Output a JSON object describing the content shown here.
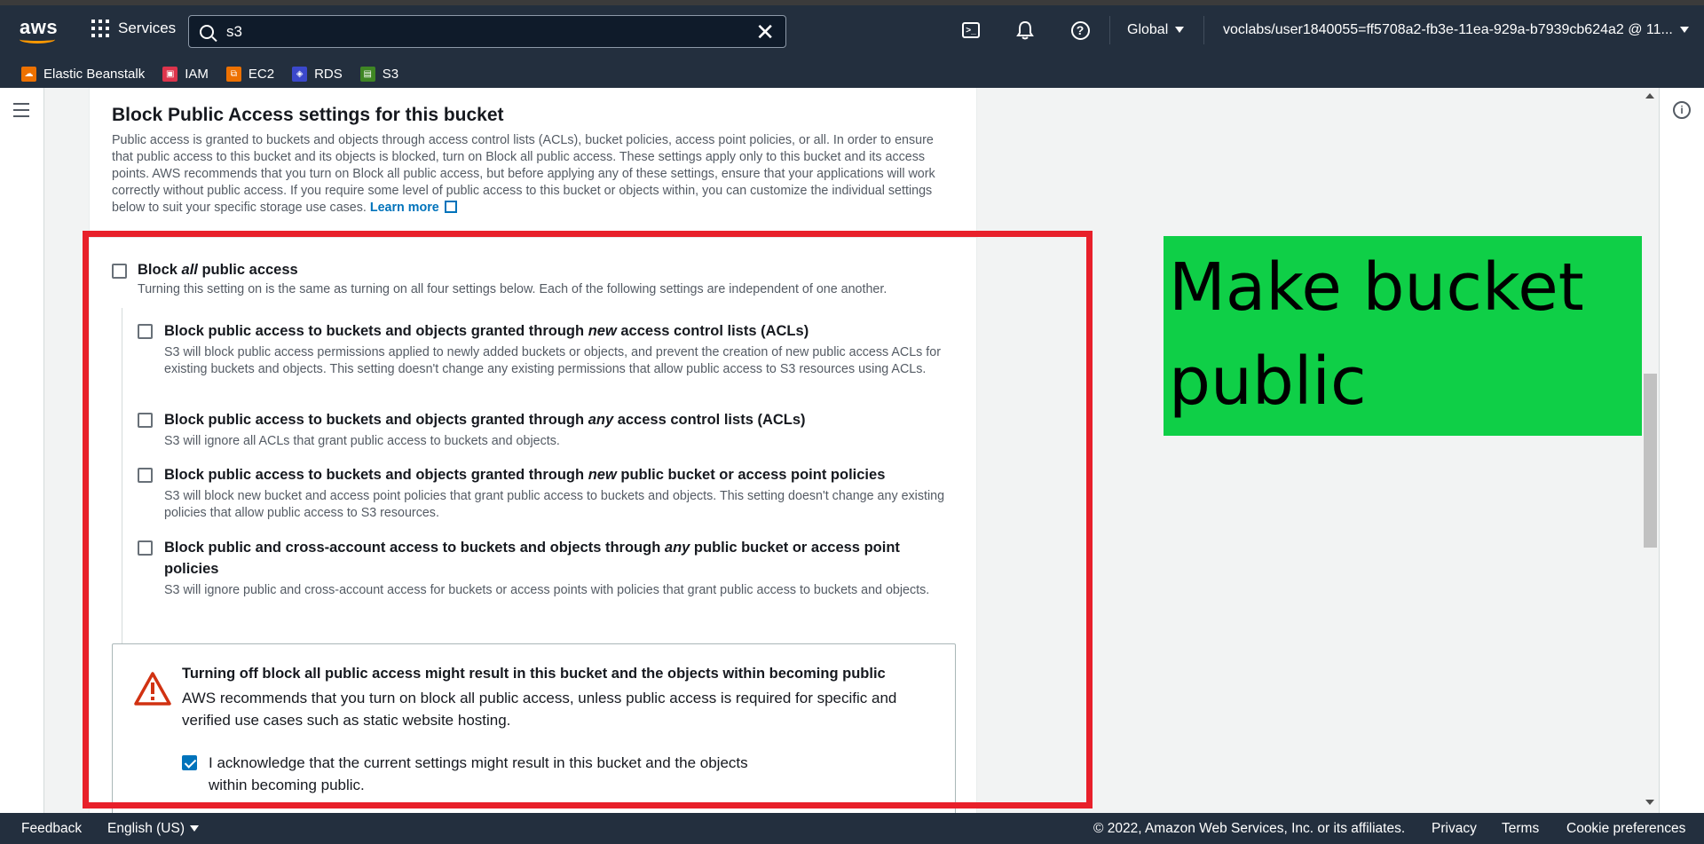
{
  "nav": {
    "logo": "aws",
    "services_label": "Services",
    "search_value": "s3",
    "clear_glyph": "✕",
    "region": "Global",
    "account": "voclabs/user1840055=ff5708a2-fb3e-11ea-929a-b7939cb624a2 @ 11...",
    "icons": [
      "cloudshell-icon",
      "bell-icon",
      "help-icon"
    ]
  },
  "favorites": [
    {
      "label": "Elastic Beanstalk",
      "color": "#ed7100",
      "icon": "beanstalk-icon"
    },
    {
      "label": "IAM",
      "color": "#dd344c",
      "icon": "iam-icon"
    },
    {
      "label": "EC2",
      "color": "#ed7100",
      "icon": "ec2-icon"
    },
    {
      "label": "RDS",
      "color": "#3b48cc",
      "icon": "rds-icon"
    },
    {
      "label": "S3",
      "color": "#3f8624",
      "icon": "s3-icon"
    }
  ],
  "section": {
    "title": "Block Public Access settings for this bucket",
    "description": "Public access is granted to buckets and objects through access control lists (ACLs), bucket policies, access point policies, or all. In order to ensure that public access to this bucket and its objects is blocked, turn on Block all public access. These settings apply only to this bucket and its access points. AWS recommends that you turn on Block all public access, but before applying any of these settings, ensure that your applications will work correctly without public access. If you require some level of public access to this bucket or objects within, you can customize the individual settings below to suit your specific storage use cases.",
    "learn_more": "Learn more"
  },
  "block_all": {
    "title_pre": "Block ",
    "title_em": "all",
    "title_post": " public access",
    "desc": "Turning this setting on is the same as turning on all four settings below. Each of the following settings are independent of one another.",
    "checked": false
  },
  "options": [
    {
      "title_pre": "Block public access to buckets and objects granted through ",
      "title_em": "new",
      "title_post": " access control lists (ACLs)",
      "desc": "S3 will block public access permissions applied to newly added buckets or objects, and prevent the creation of new public access ACLs for existing buckets and objects. This setting doesn't change any existing permissions that allow public access to S3 resources using ACLs.",
      "checked": false
    },
    {
      "title_pre": "Block public access to buckets and objects granted through ",
      "title_em": "any",
      "title_post": " access control lists (ACLs)",
      "desc": "S3 will ignore all ACLs that grant public access to buckets and objects.",
      "checked": false
    },
    {
      "title_pre": "Block public access to buckets and objects granted through ",
      "title_em": "new",
      "title_post": " public bucket or access point policies",
      "desc": "S3 will block new bucket and access point policies that grant public access to buckets and objects. This setting doesn't change any existing policies that allow public access to S3 resources.",
      "checked": false
    },
    {
      "title_pre": "Block public and cross-account access to buckets and objects through ",
      "title_em": "any",
      "title_post": " public bucket or access point policies",
      "desc": "S3 will ignore public and cross-account access for buckets or access points with policies that grant public access to buckets and objects.",
      "checked": false
    }
  ],
  "alert": {
    "title": "Turning off block all public access might result in this bucket and the objects within becoming public",
    "body": "AWS recommends that you turn on block all public access, unless public access is required for specific and verified use cases such as static website hosting.",
    "ack": "I acknowledge that the current settings might result in this bucket and the objects within becoming public.",
    "ack_checked": true
  },
  "annotation": {
    "label": "Make bucket public",
    "box_color": "#e8202a",
    "label_bg": "#0fcf47"
  },
  "footer": {
    "feedback": "Feedback",
    "language": "English (US)",
    "copyright": "© 2022, Amazon Web Services, Inc. or its affiliates.",
    "privacy": "Privacy",
    "terms": "Terms",
    "cookies": "Cookie preferences"
  }
}
